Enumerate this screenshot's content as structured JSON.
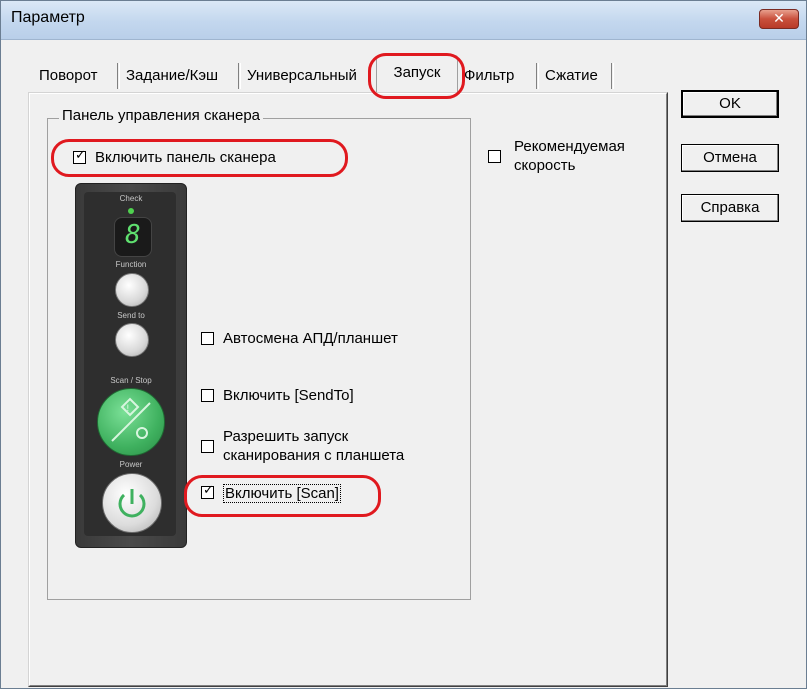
{
  "window": {
    "title": "Параметр",
    "close_glyph": "✕"
  },
  "tabs": [
    {
      "label": "Поворот"
    },
    {
      "label": "Задание/Кэш"
    },
    {
      "label": "Универсальный"
    },
    {
      "label": "Запуск",
      "active": true
    },
    {
      "label": "Фильтр"
    },
    {
      "label": "Сжатие"
    }
  ],
  "group": {
    "title": "Панель управления сканера"
  },
  "checkboxes": {
    "enable_panel": {
      "label": "Включить панель сканера",
      "checked": true
    },
    "recommended_speed": {
      "label_line1": "Рекомендуемая",
      "label_line2": "скорость",
      "checked": false
    },
    "auto_switch": {
      "label": "Автосмена АПД/планшет",
      "checked": false
    },
    "enable_sendto": {
      "label": "Включить [SendTo]",
      "checked": false
    },
    "allow_flatbed_line1": "Разрешить запуск",
    "allow_flatbed_line2": "сканирования с планшета",
    "allow_flatbed_checked": false,
    "enable_scan": {
      "label": "Включить [Scan]",
      "checked": true
    }
  },
  "check_mark": "✓",
  "scanner_panel": {
    "check_label": "Check",
    "digit": "8",
    "function_label": "Function",
    "sendto_label": "Send to",
    "scanstop_label": "Scan / Stop",
    "power_label": "Power"
  },
  "buttons": {
    "ok": "OK",
    "cancel": "Отмена",
    "help": "Справка"
  },
  "colors": {
    "highlight": "#e0191f",
    "scan_button": "#3fb15f",
    "led": "#4fd14f"
  }
}
